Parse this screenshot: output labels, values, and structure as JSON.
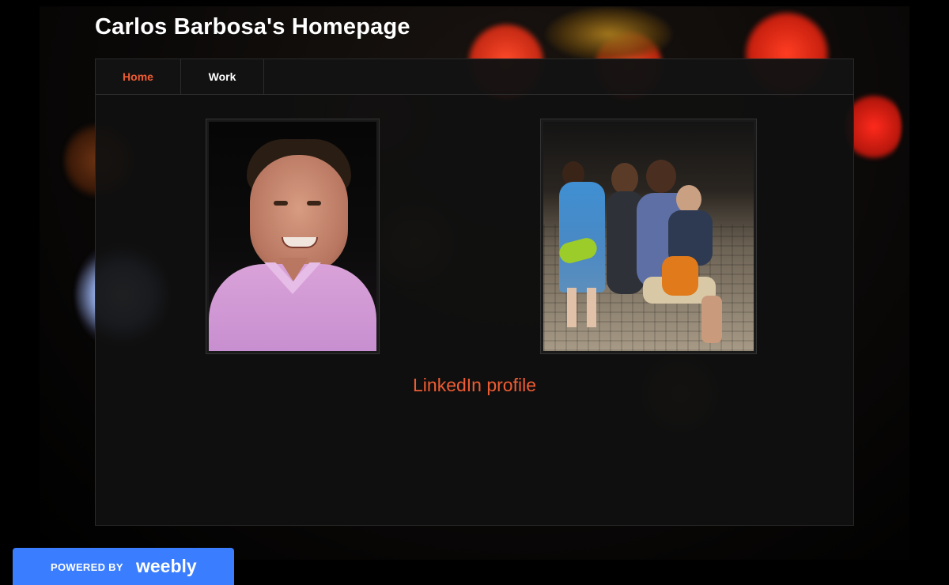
{
  "site": {
    "title": "Carlos Barbosa's Homepage"
  },
  "nav": {
    "items": [
      {
        "label": "Home",
        "active": true
      },
      {
        "label": "Work",
        "active": false
      }
    ]
  },
  "main": {
    "linkedin_label": "LinkedIn profile"
  },
  "badge": {
    "powered_by": "POWERED BY",
    "brand": "weebly"
  },
  "colors": {
    "accent": "#ee5c33",
    "badge_bg": "#3a7dff",
    "content_bg": "#101010"
  }
}
